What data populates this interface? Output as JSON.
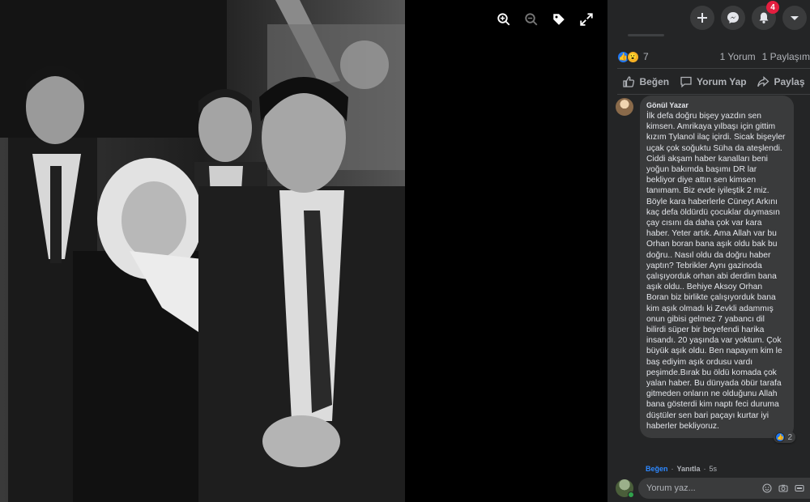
{
  "topbar": {
    "create_icon": "plus-icon",
    "messenger_icon": "messenger-icon",
    "notifications_icon": "bell-icon",
    "notifications_count": "4",
    "account_icon": "caret-down-icon"
  },
  "viewer": {
    "tools": [
      "zoom-in-icon",
      "zoom-out-icon",
      "tag-icon",
      "fullscreen-icon"
    ]
  },
  "stats": {
    "reactions_count": "7",
    "comments": "1 Yorum",
    "shares": "1 Paylaşım"
  },
  "actions": {
    "like": "Beğen",
    "comment": "Yorum Yap",
    "share": "Paylaş"
  },
  "comment": {
    "author": "Gönül Yazar",
    "text": "İlk defa doğru bişey yazdın sen kimsen. Amrikaya yılbaşı için gittim kızım Tylanol ilaç içirdi. Sicak bişeyler uçak çok soğuktu Süha da ateşlendi. Ciddi akşam haber kanalları beni yoğun bakımda başımı DR lar bekliyor diye attın sen kimsen tanımam. Biz evde iyileştik 2 miz. Böyle kara haberlerle Cüneyt Arkını kaç defa öldürdü çocuklar duymasın çay cısını da daha çok var kara haber. Yeter artık. Ama Allah var bu Orhan boran bana aşık oldu bak bu doğru.. Nasıl oldu da doğru haber yaptın? Tebrikler Aynı gazinoda çalışıyorduk orhan abi derdim bana aşık oldu.. Behiye Aksoy Orhan Boran biz birlikte çalışıyorduk bana kim aşık olmadı ki Zevkli adammış onun gibisi gelmez 7 yabancı dil bilirdi süper bir beyefendi harika insandı. 20 yaşında var yoktum. Çok büyük aşık oldu. Ben napayım kim le baş ediyim aşık ordusu vardı peşimde.Bırak bu öldü komada çok yalan haber. Bu dünyada öbür tarafa gitmeden onların ne olduğunu Allah bana gösterdi kim naptı feci duruma düştüler sen bari paçayı kurtar iyi haberler bekliyoruz.",
    "reaction_count": "2",
    "like_label": "Beğen",
    "reply_label": "Yanıtla",
    "time": "5s"
  },
  "composer": {
    "placeholder": "Yorum yaz...",
    "icons": [
      "emoji-icon",
      "camera-icon",
      "gif-icon",
      "sticker-icon"
    ]
  }
}
